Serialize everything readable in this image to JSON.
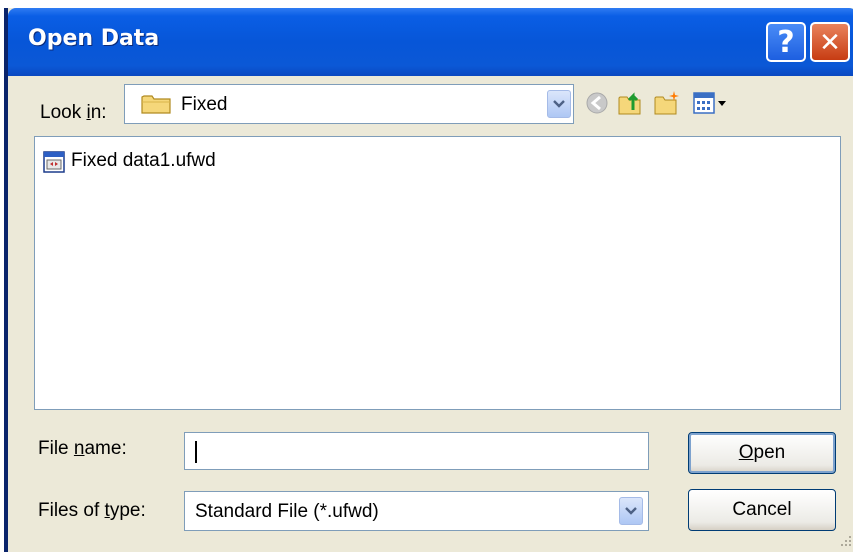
{
  "window": {
    "title": "Open Data",
    "help_label": "?",
    "close_label": "✕"
  },
  "look_in": {
    "label_pre": "Look ",
    "label_key": "i",
    "label_post": "n:",
    "value": "Fixed",
    "icon": "folder-icon"
  },
  "toolbar": {
    "icons": [
      "back-icon",
      "up-folder-icon",
      "new-folder-icon",
      "view-menu-icon"
    ]
  },
  "files": [
    {
      "name": "Fixed data1.ufwd",
      "icon": "data-file-icon"
    }
  ],
  "file_name": {
    "label_pre": "File ",
    "label_key": "n",
    "label_post": "ame:",
    "value": ""
  },
  "file_type": {
    "label_pre": "Files of ",
    "label_key": "t",
    "label_post": "ype:",
    "value": "Standard File (*.ufwd)"
  },
  "buttons": {
    "open_key": "O",
    "open_rest": "pen",
    "cancel": "Cancel"
  },
  "colors": {
    "titlebar": "#0756d8",
    "dialog_bg": "#ece9d8",
    "close": "#c73c13"
  }
}
